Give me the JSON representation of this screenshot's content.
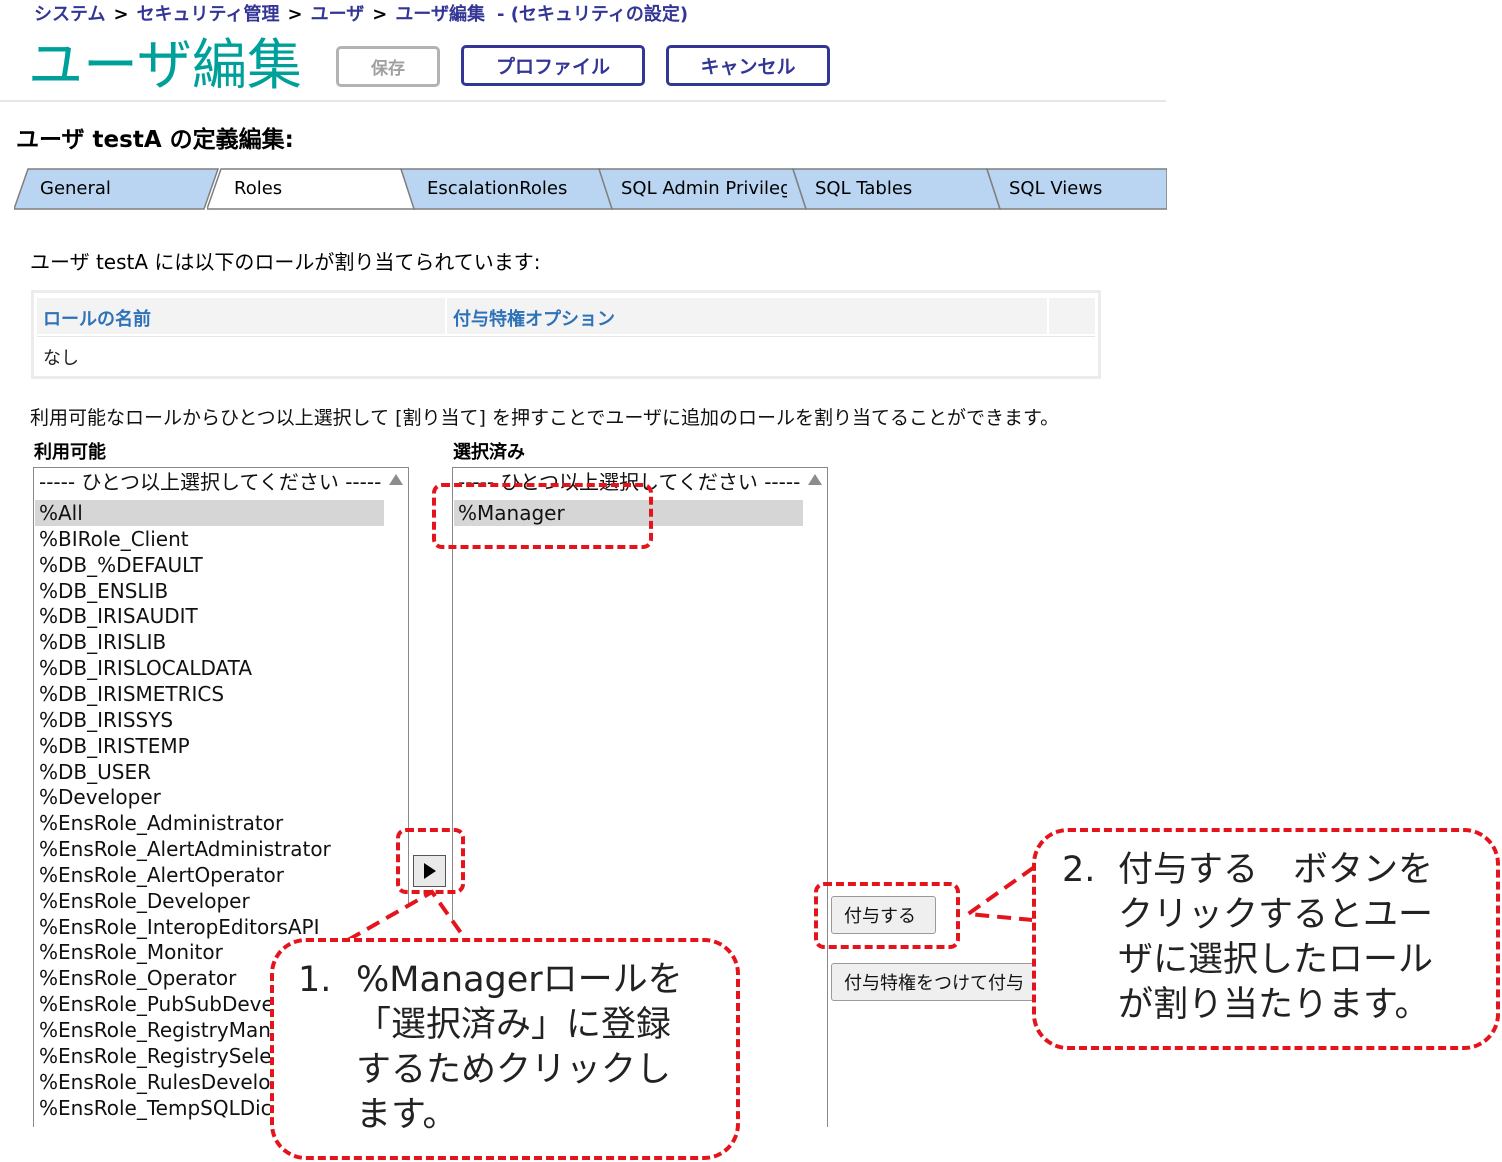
{
  "breadcrumb": {
    "items": [
      "システム",
      "セキュリティ管理",
      "ユーザ",
      "ユーザ編集"
    ],
    "separator": ">",
    "tail": "- (セキュリティの設定)"
  },
  "header": {
    "title": "ユーザ編集",
    "buttons": {
      "save": "保存",
      "profile": "プロファイル",
      "cancel": "キャンセル"
    }
  },
  "section_heading": "ユーザ testA の定義編集:",
  "tabs": [
    "General",
    "Roles",
    "EscalationRoles",
    "SQL Admin Privilege",
    "SQL Tables",
    "SQL Views"
  ],
  "active_tab": "Roles",
  "assigned_text": "ユーザ testA には以下のロールが割り当てられています:",
  "roles_table": {
    "headers": [
      "ロールの名前",
      "付与特権オプション"
    ],
    "empty_row": "なし"
  },
  "instruction": "利用可能なロールからひとつ以上選択して [割り当て] を押すことでユーザに追加のロールを割り当てることができます。",
  "available": {
    "label": "利用可能",
    "placeholder": "----- ひとつ以上選択してください -----",
    "items": [
      "%All",
      "%BIRole_Client",
      "%DB_%DEFAULT",
      "%DB_ENSLIB",
      "%DB_IRISAUDIT",
      "%DB_IRISLIB",
      "%DB_IRISLOCALDATA",
      "%DB_IRISMETRICS",
      "%DB_IRISSYS",
      "%DB_IRISTEMP",
      "%DB_USER",
      "%Developer",
      "%EnsRole_Administrator",
      "%EnsRole_AlertAdministrator",
      "%EnsRole_AlertOperator",
      "%EnsRole_Developer",
      "%EnsRole_InteropEditorsAPI",
      "%EnsRole_Monitor",
      "%EnsRole_Operator",
      "%EnsRole_PubSubDevel",
      "%EnsRole_RegistryMana",
      "%EnsRole_RegistrySelec",
      "%EnsRole_RulesDevelop",
      "%EnsRole_TempSQLDict"
    ],
    "selected_item": "%All"
  },
  "selected_list": {
    "label": "選択済み",
    "placeholder": "----- ひとつ以上選択してください -----",
    "items": [
      "%Manager"
    ]
  },
  "action_buttons": {
    "grant": "付与する",
    "grant_with_option": "付与特権をつけて付与"
  },
  "callouts": {
    "one_number": "1.",
    "one_lines": [
      "%Managerロールを",
      "「選択済み」に登録",
      "するためクリックし",
      "ます。"
    ],
    "two_number": "2.",
    "two_lines": [
      "付与する　ボタンを",
      "クリックするとユー",
      "ザに選択したロール",
      "が割り当たります。"
    ]
  },
  "colors": {
    "title": "#00a09a",
    "nav_blue": "#333695",
    "tab_fill": "#b9d5f1",
    "link_blue": "#2e72b7",
    "annotation_red": "#e5141c"
  }
}
